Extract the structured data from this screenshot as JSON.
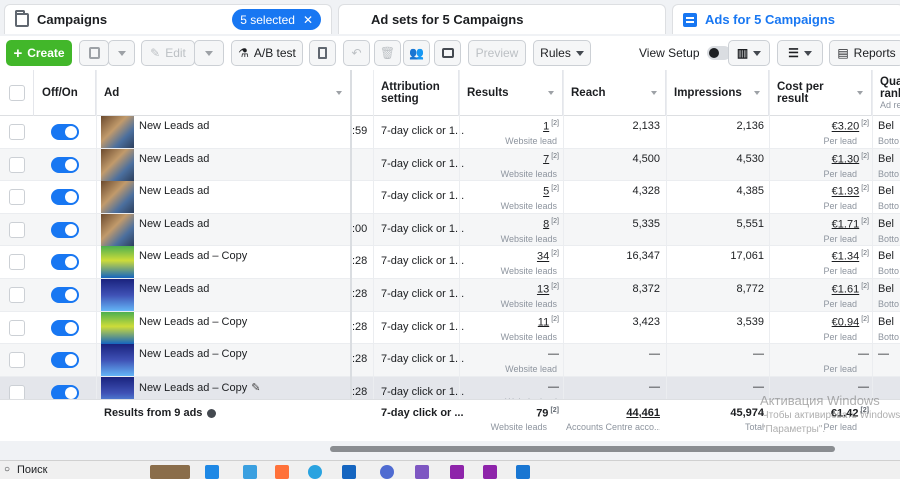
{
  "tabs": {
    "campaigns": "Campaigns",
    "selected_pill": "5 selected",
    "adsets": "Ad sets for 5 Campaigns",
    "ads": "Ads for 5 Campaigns"
  },
  "toolbar": {
    "create": "Create",
    "edit": "Edit",
    "ab_test": "A/B test",
    "preview": "Preview",
    "rules": "Rules",
    "view_setup": "View Setup",
    "reports": "Reports"
  },
  "columns": {
    "onoff": "Off/On",
    "ad": "Ad",
    "attribution": "Attribution setting",
    "results": "Results",
    "reach": "Reach",
    "impressions": "Impressions",
    "cost": "Cost per result",
    "quality": "Qual rank",
    "quality_sub": "Ad re"
  },
  "rows": [
    {
      "name": "New Leads ad",
      "cut": ":59",
      "attr": "7-day click or 1...",
      "results": "1",
      "results_sub": "Website lead",
      "reach": "2,133",
      "impressions": "2,136",
      "cost": "€3.20",
      "cost_sub": "Per lead",
      "quality": "Bel",
      "quality_sub": "Botto",
      "thumb": "photo"
    },
    {
      "name": "New Leads ad",
      "cut": "",
      "attr": "7-day click or 1...",
      "results": "7",
      "results_sub": "Website leads",
      "reach": "4,500",
      "impressions": "4,530",
      "cost": "€1.30",
      "cost_sub": "Per lead",
      "quality": "Bel",
      "quality_sub": "Botto",
      "thumb": "photo"
    },
    {
      "name": "New Leads ad",
      "cut": "",
      "attr": "7-day click or 1...",
      "results": "5",
      "results_sub": "Website leads",
      "reach": "4,328",
      "impressions": "4,385",
      "cost": "€1.93",
      "cost_sub": "Per lead",
      "quality": "Bel",
      "quality_sub": "Botto",
      "thumb": "photo"
    },
    {
      "name": "New Leads ad",
      "cut": ":00",
      "attr": "7-day click or 1...",
      "results": "8",
      "results_sub": "Website leads",
      "reach": "5,335",
      "impressions": "5,551",
      "cost": "€1.71",
      "cost_sub": "Per lead",
      "quality": "Bel",
      "quality_sub": "Botto",
      "thumb": "photo"
    },
    {
      "name": "New Leads ad – Copy",
      "cut": ":28",
      "attr": "7-day click or 1...",
      "results": "34",
      "results_sub": "Website leads",
      "reach": "16,347",
      "impressions": "17,061",
      "cost": "€1.34",
      "cost_sub": "Per lead",
      "quality": "Bel",
      "quality_sub": "Botto",
      "thumb": "green"
    },
    {
      "name": "New Leads ad",
      "cut": ":28",
      "attr": "7-day click or 1...",
      "results": "13",
      "results_sub": "Website leads",
      "reach": "8,372",
      "impressions": "8,772",
      "cost": "€1.61",
      "cost_sub": "Per lead",
      "quality": "Bel",
      "quality_sub": "Botto",
      "thumb": "blue"
    },
    {
      "name": "New Leads ad – Copy",
      "cut": ":28",
      "attr": "7-day click or 1...",
      "results": "11",
      "results_sub": "Website leads",
      "reach": "3,423",
      "impressions": "3,539",
      "cost": "€0.94",
      "cost_sub": "Per lead",
      "quality": "Bel",
      "quality_sub": "Botto",
      "thumb": "green"
    },
    {
      "name": "New Leads ad – Copy",
      "cut": ":28",
      "attr": "7-day click or 1...",
      "results": "—",
      "results_sub": "Website lead",
      "reach": "—",
      "impressions": "—",
      "cost": "—",
      "cost_sub": "Per lead",
      "quality": "—",
      "quality_sub": "",
      "thumb": "blue"
    },
    {
      "name": "New Leads ad – Copy",
      "cut": ":28",
      "attr": "7-day click or 1...",
      "results": "—",
      "results_sub": "Website lead",
      "reach": "—",
      "impressions": "—",
      "cost": "—",
      "cost_sub": "",
      "quality": "",
      "quality_sub": "",
      "thumb": "blue"
    }
  ],
  "totals": {
    "label": "Results from 9 ads",
    "attr": "7-day click or ...",
    "results": "79",
    "results_sub": "Website leads",
    "reach": "44,461",
    "reach_sub": "Accounts Centre acco...",
    "impressions": "45,974",
    "impressions_sub": "Total",
    "cost": "€1.42",
    "cost_sub": "Per lead"
  },
  "footnote_mark": "[2]",
  "watermark": {
    "line1": "Активация Windows",
    "line2": "Чтобы активировать Windows,",
    "line3": "\"Параметры\"."
  },
  "taskbar": {
    "search": "Поиск"
  }
}
